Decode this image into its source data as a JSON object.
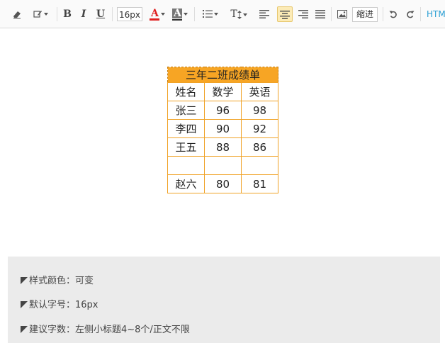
{
  "toolbar": {
    "font_size": "16px",
    "indent_label": "缩进",
    "html_label": "HTM",
    "bold_label": "B",
    "italic_label": "I",
    "underline_label": "U",
    "font_color_label": "A",
    "bg_color_label": "A",
    "text_direction_label": "T",
    "colors": {
      "accent_active": "#fcebb6",
      "font_color_bar": "#e02020",
      "link": "#2b9fd4"
    }
  },
  "table": {
    "title": "三年二班成绩单",
    "headers": [
      "姓名",
      "数学",
      "英语"
    ],
    "rows": [
      [
        "张三",
        "96",
        "98"
      ],
      [
        "李四",
        "90",
        "92"
      ],
      [
        "王五",
        "88",
        "86"
      ],
      [
        "",
        "",
        ""
      ],
      [
        "赵六",
        "80",
        "81"
      ]
    ],
    "colors": {
      "title_bg": "#f7a524",
      "border": "#f0a226"
    }
  },
  "info": {
    "lines": [
      "样式颜色：可变",
      "默认字号：16px",
      "建议字数：左侧小标题4~8个/正文不限"
    ]
  }
}
